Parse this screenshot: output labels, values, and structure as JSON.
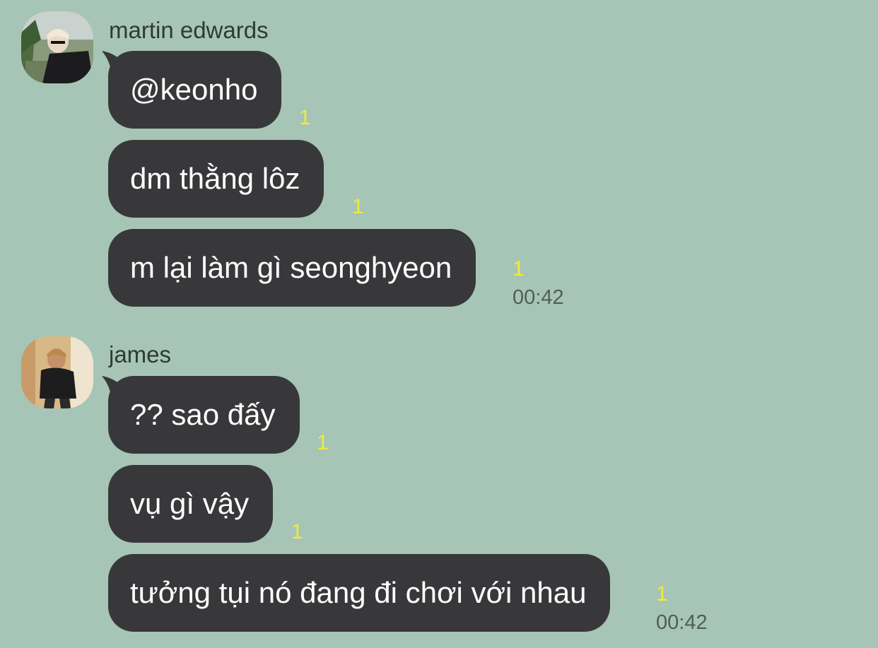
{
  "conversation": [
    {
      "sender": "martin edwards",
      "avatar_icon": "user-avatar-photo",
      "messages": [
        {
          "text": "@keonho",
          "unread": "1"
        },
        {
          "text": "dm thằng lôz",
          "unread": "1"
        },
        {
          "text": "m lại làm gì seonghyeon",
          "unread": "1",
          "time": "00:42"
        }
      ]
    },
    {
      "sender": "james",
      "avatar_icon": "user-avatar-photo",
      "messages": [
        {
          "text": "?? sao đấy",
          "unread": "1"
        },
        {
          "text": "vụ gì vậy",
          "unread": "1"
        },
        {
          "text": "tưởng tụi nó đang đi chơi với nhau",
          "unread": "1",
          "time": "00:42"
        }
      ]
    }
  ],
  "colors": {
    "background": "#a6c5b6",
    "bubble": "#38383b",
    "bubble_text": "#ffffff",
    "unread": "#f2ea3c",
    "timestamp": "#4f5e58"
  }
}
